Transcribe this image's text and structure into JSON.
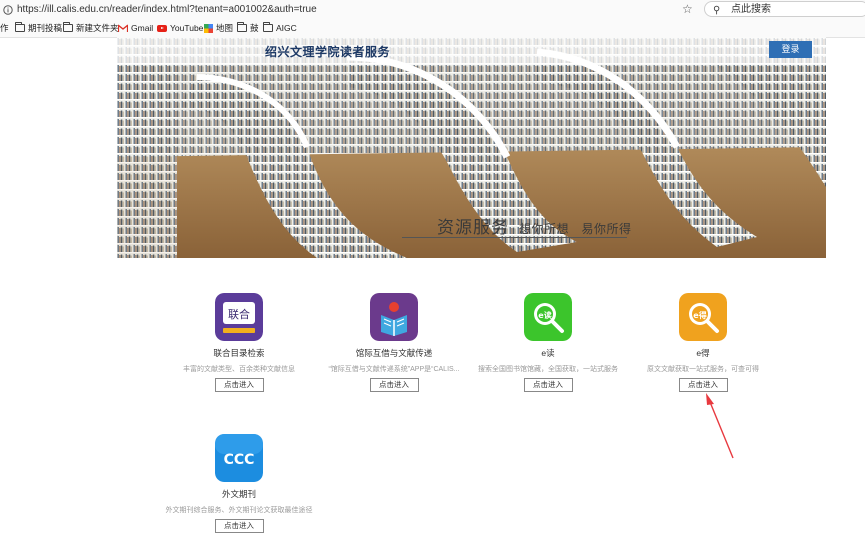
{
  "browser": {
    "url": "https://ill.calis.edu.cn/reader/index.html?tenant=a001002&auth=true",
    "search_placeholder": "点此搜索"
  },
  "bookmarks": [
    {
      "label": "作",
      "icon": "none"
    },
    {
      "label": "期刊投稿",
      "icon": "folder-icon"
    },
    {
      "label": "新建文件夹",
      "icon": "folder-icon"
    },
    {
      "label": "Gmail",
      "icon": "gmail-icon"
    },
    {
      "label": "YouTube",
      "icon": "youtube-icon"
    },
    {
      "label": "地图",
      "icon": "maps-icon"
    },
    {
      "label": "鼓",
      "icon": "folder-icon"
    },
    {
      "label": "AIGC",
      "icon": "folder-icon"
    }
  ],
  "header": {
    "title": "绍兴文理学院读者服务",
    "login_label": "登录"
  },
  "banner": {
    "slogan_main": "资源服务",
    "slogan_sub": "想你所想　易你所得"
  },
  "services": [
    {
      "name": "联合目录检索",
      "desc": "丰富的文献类型、百余类种文献信息",
      "button": "点击进入",
      "icon_text": "联合",
      "color": "#5b3c9a"
    },
    {
      "name": "馆际互借与文献传递",
      "desc": "“馆际互借与文献传递系统”APP是“CALIS...",
      "button": "点击进入",
      "icon_text": "",
      "color": "#6b3a8c"
    },
    {
      "name": "e读",
      "desc": "搜索全国图书馆馆藏，全国获取，一站式服务",
      "button": "点击进入",
      "icon_text": "e读",
      "color": "#3cc52c"
    },
    {
      "name": "e得",
      "desc": "原文文献获取一站式服务，可查可得",
      "button": "点击进入",
      "icon_text": "e得",
      "color": "#f0a21e"
    },
    {
      "name": "外文期刊",
      "desc": "外文期刊综合服务、外文期刊论文获取最佳途径",
      "button": "点击进入",
      "icon_text": "CCC",
      "color": "#1c8de0"
    }
  ],
  "colors": {
    "accent": "#2f6fb5",
    "title": "#1e3a66",
    "annotation_arrow": "#e8393f"
  }
}
